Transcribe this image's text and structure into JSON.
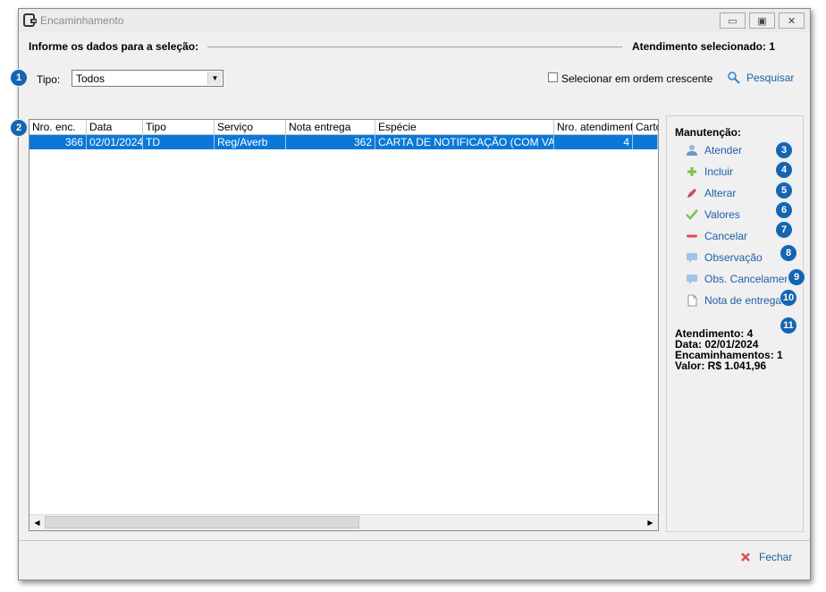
{
  "window": {
    "title": "Encaminhamento"
  },
  "header": {
    "left_label": "Informe os dados para a seleção:",
    "right_label": "Atendimento selecionado: 1"
  },
  "filter": {
    "tipo_label": "Tipo:",
    "tipo_value": "Todos",
    "order_checkbox_label": "Selecionar em ordem crescente",
    "search_label": "Pesquisar"
  },
  "grid": {
    "columns": [
      "Nro. enc.",
      "Data",
      "Tipo",
      "Serviço",
      "Nota entrega",
      "Espécie",
      "Nro. atendimento",
      "Cartó"
    ],
    "rows": [
      [
        "366",
        "02/01/2024",
        "TD",
        "Reg/Averb",
        "362",
        "CARTA DE NOTIFICAÇÃO (COM VAL...",
        "4",
        ""
      ]
    ]
  },
  "maintenance": {
    "title": "Manutenção:",
    "actions": [
      {
        "label": "Atender",
        "icon": "user-icon"
      },
      {
        "label": "Incluir",
        "icon": "plus-icon"
      },
      {
        "label": "Alterar",
        "icon": "pencil-icon"
      },
      {
        "label": "Valores",
        "icon": "check-icon"
      },
      {
        "label": "Cancelar",
        "icon": "minus-icon"
      },
      {
        "label": "Observação",
        "icon": "comment-icon"
      },
      {
        "label": "Obs. Cancelamento",
        "icon": "comment-icon"
      },
      {
        "label": "Nota de entrega",
        "icon": "document-icon"
      }
    ],
    "info": {
      "atendimento": "Atendimento: 4",
      "data": "Data: 02/01/2024",
      "encaminhamentos": "Encaminhamentos: 1",
      "valor": "Valor: R$ 1.041,96"
    }
  },
  "badges": [
    "1",
    "2",
    "3",
    "4",
    "5",
    "6",
    "7",
    "8",
    "9",
    "10",
    "11"
  ],
  "footer": {
    "close_label": "Fechar"
  },
  "colors": {
    "selection": "#0a78d7",
    "badge": "#1565b0",
    "link": "#1f5ea8"
  }
}
